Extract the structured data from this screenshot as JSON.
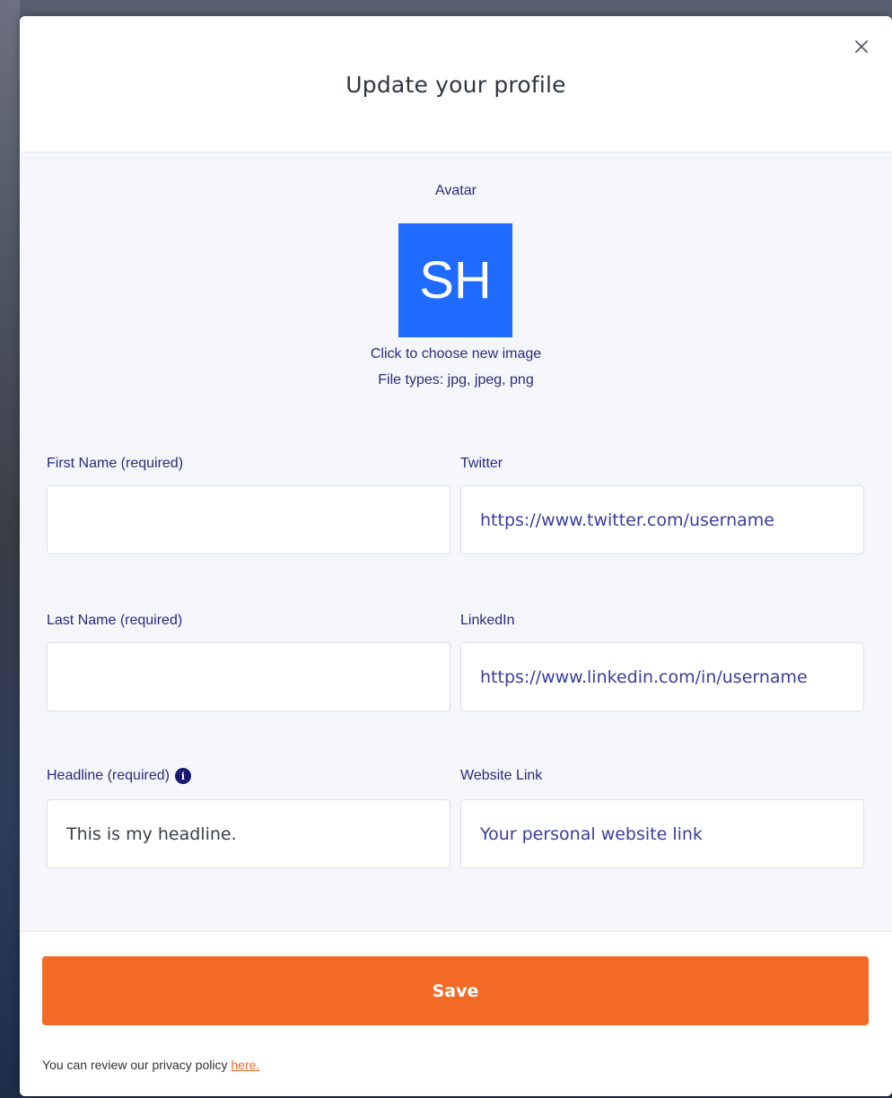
{
  "modal": {
    "title": "Update your profile"
  },
  "avatar": {
    "label": "Avatar",
    "initials": "SH",
    "color": "#1f6bff",
    "hint": "Click to choose new image",
    "file_types": "File types: jpg, jpeg, png"
  },
  "fields": {
    "first_name": {
      "label": "First Name (required)",
      "value": "",
      "placeholder": ""
    },
    "last_name": {
      "label": "Last Name (required)",
      "value": "",
      "placeholder": ""
    },
    "headline": {
      "label": "Headline (required)",
      "value": "This is my headline.",
      "placeholder": ""
    },
    "twitter": {
      "label": "Twitter",
      "value": "",
      "placeholder": "https://www.twitter.com/username"
    },
    "linkedin": {
      "label": "LinkedIn",
      "value": "",
      "placeholder": "https://www.linkedin.com/in/username"
    },
    "website": {
      "label": "Website Link",
      "value": "",
      "placeholder": "Your personal website link"
    }
  },
  "footer": {
    "save_label": "Save",
    "save_color": "#f26a26",
    "privacy_text": "You can review our privacy policy ",
    "privacy_link": "here."
  },
  "icons": {
    "close": "close-icon",
    "info": "info-icon"
  }
}
